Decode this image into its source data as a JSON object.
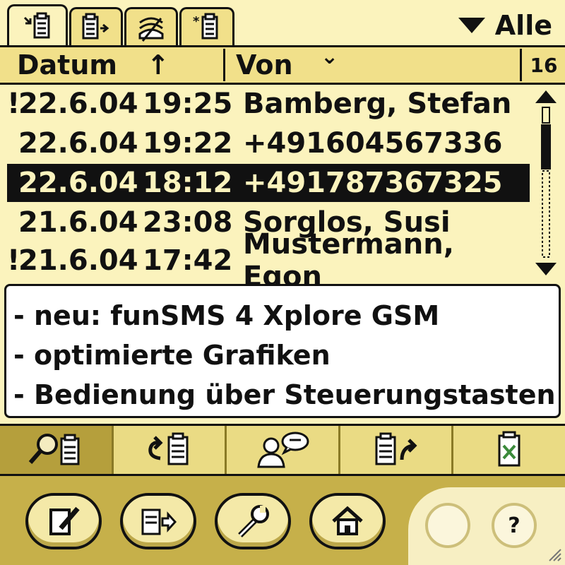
{
  "tabs": [
    {
      "name": "inbox-tab",
      "icon": "inbox-document-icon",
      "active": true
    },
    {
      "name": "outbox-tab",
      "icon": "outgoing-document-icon",
      "active": false
    },
    {
      "name": "archive-tab",
      "icon": "stacked-documents-icon",
      "active": false
    },
    {
      "name": "drafts-tab",
      "icon": "starred-document-icon",
      "active": false
    }
  ],
  "filter": {
    "label": "Alle",
    "icon": "dropdown-triangle-icon"
  },
  "header": {
    "col_date": "Datum",
    "sort_arrow": "↑",
    "col_from": "Von",
    "col_from_arrow": "⌄",
    "count": "16"
  },
  "messages": [
    {
      "flag": "!",
      "date": "22.6.04",
      "time": "19:25",
      "from": "Bamberg, Stefan",
      "selected": false
    },
    {
      "flag": "",
      "date": "22.6.04",
      "time": "19:22",
      "from": "+491604567336",
      "selected": false
    },
    {
      "flag": "",
      "date": "22.6.04",
      "time": "18:12",
      "from": "+491787367325",
      "selected": true
    },
    {
      "flag": "",
      "date": "21.6.04",
      "time": "23:08",
      "from": "Sorglos, Susi",
      "selected": false
    },
    {
      "flag": "!",
      "date": "21.6.04",
      "time": "17:42",
      "from": "Mustermann, Egon",
      "selected": false
    }
  ],
  "preview": {
    "line1": "- neu: funSMS 4 Xplore GSM",
    "line2": "- optimierte Grafiken",
    "line3": "- Bedienung über Steuerungstasten"
  },
  "actions": [
    "search-message-icon",
    "reply-icon",
    "contact-chat-icon",
    "forward-icon",
    "delete-document-icon"
  ],
  "bottom_buttons": [
    "edit-icon",
    "export-icon",
    "wrench-icon",
    "home-icon"
  ],
  "soft_buttons": {
    "help": "?"
  },
  "colors": {
    "background": "#fbf3bd",
    "header": "#f1e08a",
    "selection": "#111111",
    "bar": "#c6b04a"
  }
}
